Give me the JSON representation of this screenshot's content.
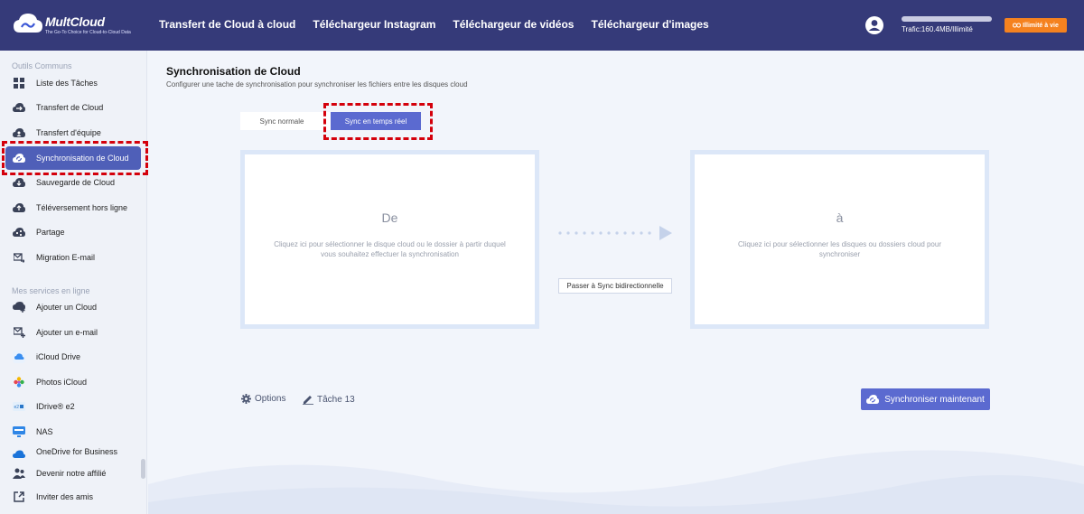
{
  "header": {
    "logo_name": "MultCloud",
    "logo_tagline": "The Go-To Choice for Cloud-to-Cloud Data",
    "nav": [
      {
        "label": "Transfert de Cloud à cloud"
      },
      {
        "label": "Téléchargeur Instagram"
      },
      {
        "label": "Téléchargeur de vidéos"
      },
      {
        "label": "Téléchargeur d'images"
      }
    ],
    "traffic_text": "Trafic:160.4MB/Illimité",
    "traffic_fraction": 0.0,
    "unlimited_button": "Illimité à vie",
    "accent_color": "#f5821f",
    "bar_color": "#353a79"
  },
  "sidebar": {
    "section1": "Outils Communs",
    "tools": [
      {
        "label": "Liste des Tâches",
        "icon": "grid-icon"
      },
      {
        "label": "Transfert de Cloud",
        "icon": "cloud-transfer-icon"
      },
      {
        "label": "Transfert d'équipe",
        "icon": "team-transfer-icon"
      },
      {
        "label": "Synchronisation de Cloud",
        "icon": "cloud-sync-icon"
      },
      {
        "label": "Sauvegarde de Cloud",
        "icon": "cloud-backup-icon"
      },
      {
        "label": "Téléversement hors ligne",
        "icon": "cloud-upload-icon"
      },
      {
        "label": "Partage",
        "icon": "share-icon"
      },
      {
        "label": "Migration E-mail",
        "icon": "email-migration-icon"
      }
    ],
    "section2": "Mes services en ligne",
    "services": [
      {
        "label": "Ajouter un Cloud",
        "icon": "add-cloud-icon"
      },
      {
        "label": "Ajouter un e-mail",
        "icon": "add-email-icon"
      },
      {
        "label": "iCloud Drive",
        "icon": "icloud-drive-icon"
      },
      {
        "label": "Photos iCloud",
        "icon": "icloud-photos-icon"
      },
      {
        "label": "IDrive® e2",
        "icon": "idrive-icon"
      },
      {
        "label": "NAS",
        "icon": "nas-icon"
      },
      {
        "label": "OneDrive for Business",
        "icon": "onedrive-icon"
      }
    ],
    "bottom": [
      {
        "label": "Devenir notre affilié",
        "icon": "affiliate-icon"
      },
      {
        "label": "Inviter des amis",
        "icon": "invite-icon"
      }
    ],
    "active_color": "#4f5fb8"
  },
  "main": {
    "title": "Synchronisation de Cloud",
    "subtitle": "Configurer une tache de synchronisation pour synchroniser les fichiers entre les disques cloud",
    "tab_normal": "Sync normale",
    "tab_realtime": "Sync en temps réel",
    "from_title": "De",
    "from_text": "Cliquez ici pour sélectionner le disque cloud ou le dossier à partir duquel vous souhaitez effectuer la synchronisation",
    "to_title": "à",
    "to_text": "Cliquez ici pour sélectionner les disques ou dossiers cloud pour synchroniser",
    "bidirectional_button": "Passer à Sync bidirectionnelle",
    "options_label": "Options",
    "task_label": "Tâche 13",
    "sync_button": "Synchroniser maintenant"
  }
}
